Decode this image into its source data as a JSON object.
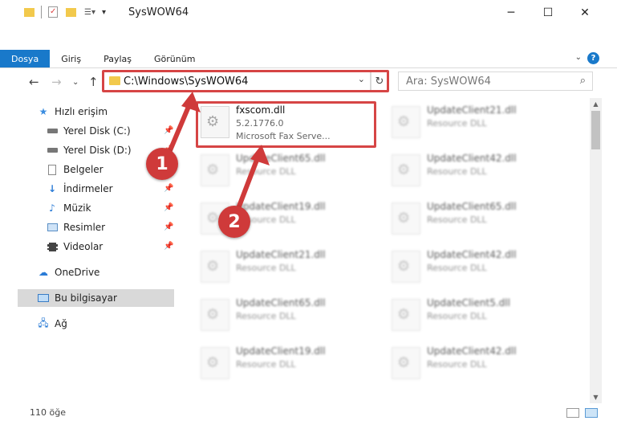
{
  "window": {
    "title": "SysWOW64",
    "minimize": "─",
    "maximize": "☐",
    "close": "✕"
  },
  "ribbon": {
    "tabs": [
      "Dosya",
      "Giriş",
      "Paylaş",
      "Görünüm"
    ],
    "help": "?"
  },
  "nav": {
    "address": "C:\\Windows\\SysWOW64",
    "search_placeholder": "Ara: SysWOW64"
  },
  "sidebar": {
    "items": [
      {
        "label": "Hızlı erişim",
        "icon": "star-icon"
      },
      {
        "label": "Yerel Disk (C:)",
        "icon": "drive-icon"
      },
      {
        "label": "Yerel Disk (D:)",
        "icon": "drive-icon"
      },
      {
        "label": "Belgeler",
        "icon": "document-icon"
      },
      {
        "label": "İndirmeler",
        "icon": "download-icon"
      },
      {
        "label": "Müzik",
        "icon": "music-icon"
      },
      {
        "label": "Resimler",
        "icon": "picture-icon"
      },
      {
        "label": "Videolar",
        "icon": "video-icon"
      },
      {
        "label": "OneDrive",
        "icon": "cloud-icon"
      },
      {
        "label": "Bu bilgisayar",
        "icon": "computer-icon"
      },
      {
        "label": "Ağ",
        "icon": "network-icon"
      }
    ]
  },
  "files": {
    "highlighted": {
      "name": "fxscom.dll",
      "version": "5.2.1776.0",
      "description": "Microsoft Fax Serve..."
    },
    "left": [
      {
        "name": "UpdateClient65.dll",
        "description": "Resource DLL"
      },
      {
        "name": "UpdateClient19.dll",
        "description": "Resource DLL"
      },
      {
        "name": "UpdateClient21.dll",
        "description": "Resource DLL"
      },
      {
        "name": "UpdateClient65.dll",
        "description": "Resource DLL"
      },
      {
        "name": "UpdateClient19.dll",
        "description": "Resource DLL"
      }
    ],
    "right": [
      {
        "name": "UpdateClient21.dll",
        "description": "Resource DLL"
      },
      {
        "name": "UpdateClient42.dll",
        "description": "Resource DLL"
      },
      {
        "name": "UpdateClient65.dll",
        "description": "Resource DLL"
      },
      {
        "name": "UpdateClient42.dll",
        "description": "Resource DLL"
      },
      {
        "name": "UpdateClient5.dll",
        "description": "Resource DLL"
      },
      {
        "name": "UpdateClient42.dll",
        "description": "Resource DLL"
      }
    ]
  },
  "status": {
    "count": "110 öğe"
  },
  "callouts": {
    "one": "1",
    "two": "2"
  },
  "colors": {
    "accent": "#1979ca",
    "highlight": "#d64545",
    "folder": "#f2c94c"
  }
}
